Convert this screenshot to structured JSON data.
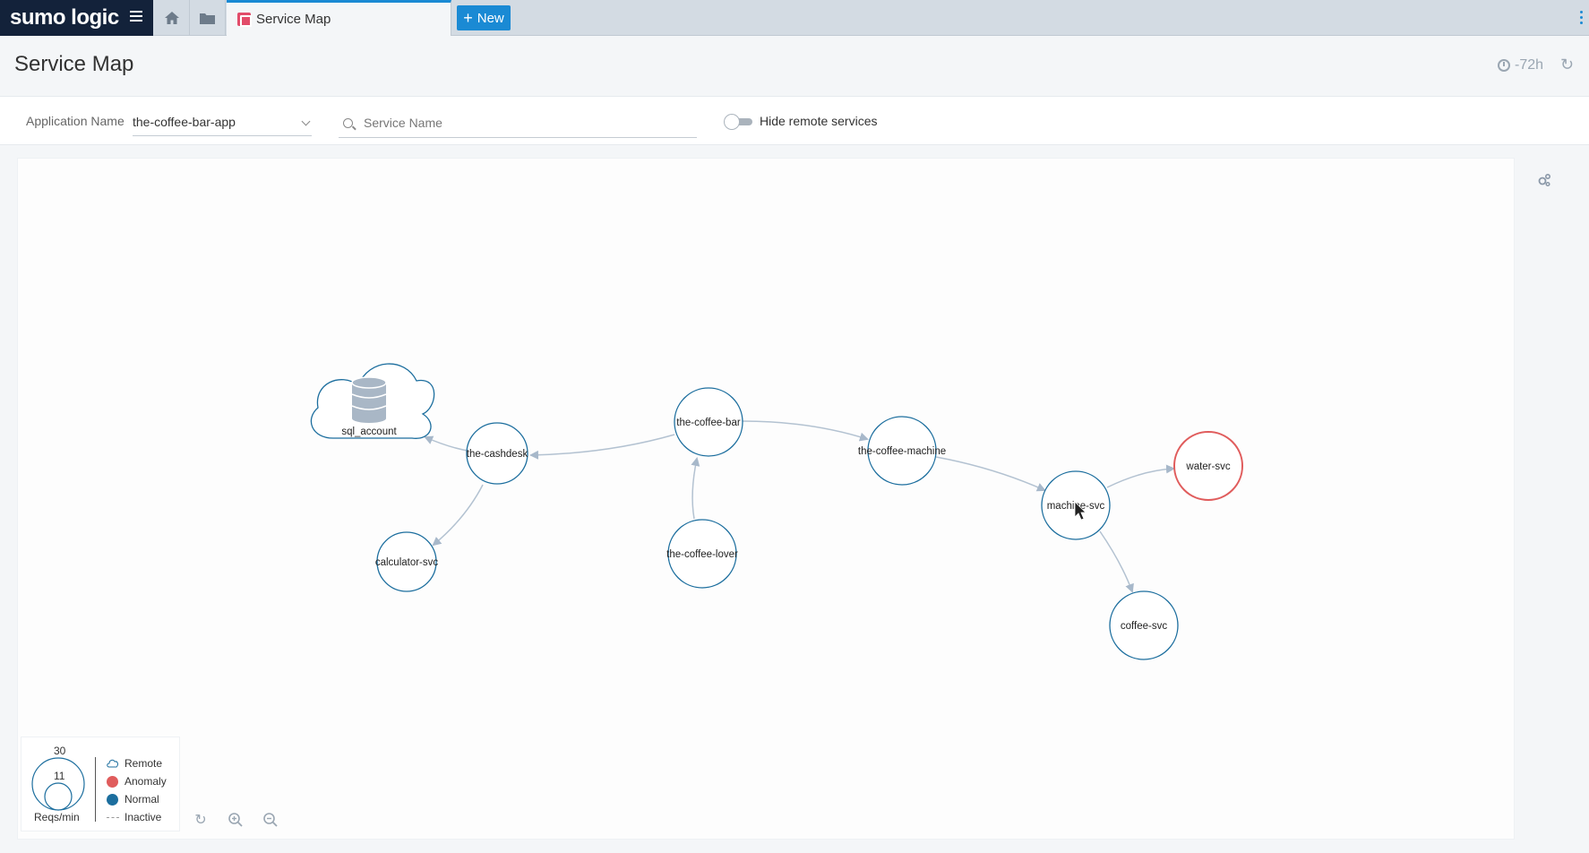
{
  "app": {
    "brand": "sumo logic"
  },
  "toolbar": {
    "tab_label": "Service Map",
    "new_label": "New"
  },
  "page": {
    "title": "Service Map",
    "time_range": "-72h"
  },
  "filters": {
    "app_name_label": "Application Name",
    "app_name_value": "the-coffee-bar-app",
    "service_placeholder": "Service Name",
    "hide_remote_label": "Hide remote services",
    "hide_remote_on": false
  },
  "map": {
    "nodes": [
      {
        "id": "sql_account",
        "label": "sql_account",
        "kind": "remote"
      },
      {
        "id": "the-cashdesk",
        "label": "the-cashdesk",
        "kind": "normal"
      },
      {
        "id": "calculator-svc",
        "label": "calculator-svc",
        "kind": "normal"
      },
      {
        "id": "the-coffee-bar",
        "label": "the-coffee-bar",
        "kind": "normal"
      },
      {
        "id": "the-coffee-lover",
        "label": "the-coffee-lover",
        "kind": "normal"
      },
      {
        "id": "the-coffee-machine",
        "label": "the-coffee-machine",
        "kind": "normal"
      },
      {
        "id": "machine-svc",
        "label": "machine-svc",
        "kind": "normal"
      },
      {
        "id": "water-svc",
        "label": "water-svc",
        "kind": "anomaly"
      },
      {
        "id": "coffee-svc",
        "label": "coffee-svc",
        "kind": "normal"
      }
    ],
    "edges": [
      [
        "the-cashdesk",
        "sql_account"
      ],
      [
        "the-cashdesk",
        "calculator-svc"
      ],
      [
        "the-coffee-bar",
        "the-cashdesk"
      ],
      [
        "the-coffee-lover",
        "the-coffee-bar"
      ],
      [
        "the-coffee-bar",
        "the-coffee-machine"
      ],
      [
        "the-coffee-machine",
        "machine-svc"
      ],
      [
        "machine-svc",
        "water-svc"
      ],
      [
        "machine-svc",
        "coffee-svc"
      ]
    ]
  },
  "legend": {
    "size_max": "30",
    "size_min": "11",
    "size_label": "Reqs/min",
    "items": [
      "Remote",
      "Anomaly",
      "Normal",
      "Inactive"
    ]
  },
  "colors": {
    "accent": "#1a8ad4",
    "normal": "#1c6e9e",
    "anomaly": "#e05c5c",
    "edge": "#b3c2d1"
  },
  "icons": [
    "menu-icon",
    "home-icon",
    "folder-icon",
    "clock-icon",
    "refresh-icon",
    "search-icon",
    "settings-icon",
    "database-icon",
    "zoom-in-icon",
    "zoom-out-icon",
    "reset-icon"
  ]
}
